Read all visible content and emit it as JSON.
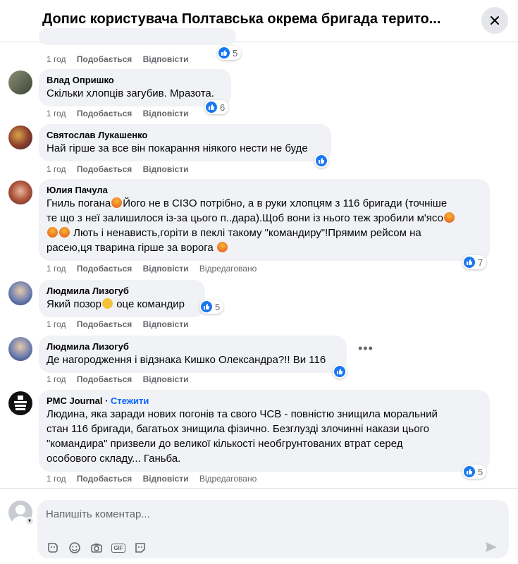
{
  "header": {
    "title": "Допис користувача Полтавська окрема бригада терито..."
  },
  "labels": {
    "like": "Подобається",
    "reply": "Відповісти",
    "edited": "Відредаговано"
  },
  "comments": [
    {
      "time": "1 год",
      "reactions": "5"
    },
    {
      "author": "Влад Опришко",
      "text": [
        "Скільки хлопців загубив. Мразота."
      ],
      "time": "1 год",
      "reactions": "6"
    },
    {
      "author": "Святослав Лукашенко",
      "text": [
        "Най гірше за все він покарання ніякого нести не буде"
      ],
      "time": "1 год",
      "reactions": ""
    },
    {
      "author": "Юлия Пачула",
      "text": [
        "Гниль погана",
        "Його не в СІЗО потрібно, а в руки хлопцям з 116 бригади (точніше",
        "те що з неї залишилося із-за цього п..дара).Щоб вони із нього теж зробили м'ясо",
        "Лють і ненависть,горіти в пеклі такому \"командиру\"!Прямим рейсом на",
        "расею,ця тварина гірше за ворога"
      ],
      "time": "1 год",
      "reactions": "7"
    },
    {
      "author": "Людмила Лизогуб",
      "text": [
        "Який позор",
        "оце командир"
      ],
      "time": "1 год",
      "reactions": "5"
    },
    {
      "author": "Людмила Лизогуб",
      "text": [
        "Де нагородження і відзнака Кишко Олександра?!! Ви 116"
      ],
      "time": "1 год",
      "reactions": ""
    },
    {
      "author": "PMC Journal",
      "follow": "Стежити",
      "text": [
        "Людина, яка заради нових погонів та свого ЧСВ - повністю знищила моральний",
        "стан 116 бригади, багатьох знищила фізично. Безглузді злочинні накази цього",
        "\"командира\" призвели до великої кількості необгрунтованих втрат серед",
        "особового складу... Ганьба."
      ],
      "time": "1 год",
      "reactions": "5"
    }
  ],
  "compose": {
    "placeholder": "Напишіть коментар...",
    "gif_label": "GIF"
  },
  "icons": [
    "close-icon",
    "like-icon",
    "more-icon",
    "sticker-icon",
    "emoji-icon",
    "camera-icon",
    "gif-icon",
    "avatar-sticker-icon",
    "send-icon"
  ],
  "colors": {
    "accent": "#0866ff",
    "like": "#1877f2",
    "bubble": "#f0f2f5",
    "secondary_text": "#65676b"
  }
}
